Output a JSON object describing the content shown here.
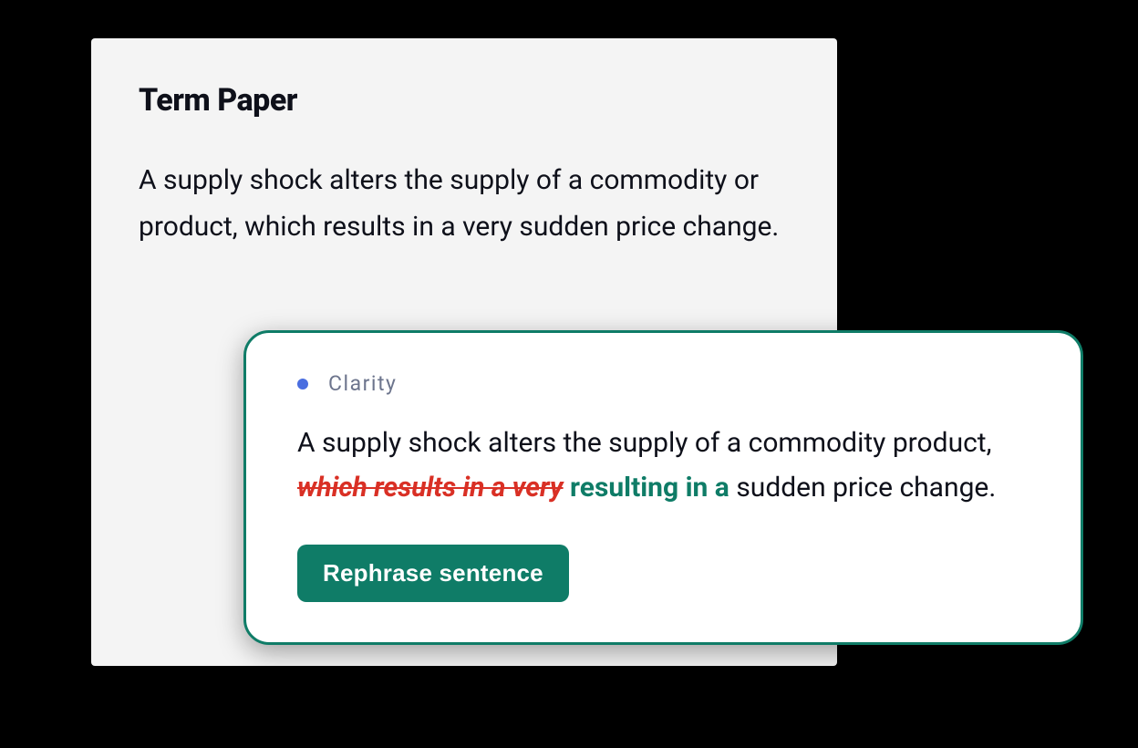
{
  "document": {
    "title": "Term Paper",
    "body": "A supply shock alters the supply of a commodity or product, which results in a very sudden price change."
  },
  "suggestion": {
    "category": "Clarity",
    "category_dot_color": "#4a6ee0",
    "text_before": "A supply shock alters the supply of a commodity product, ",
    "strike": "which results in a very",
    "insert": " resulting in a",
    "text_after": " sudden price change.",
    "action_label": "Rephrase sentence"
  },
  "colors": {
    "accent": "#0f7c67",
    "strike": "#d93025",
    "muted": "#6d758d"
  }
}
